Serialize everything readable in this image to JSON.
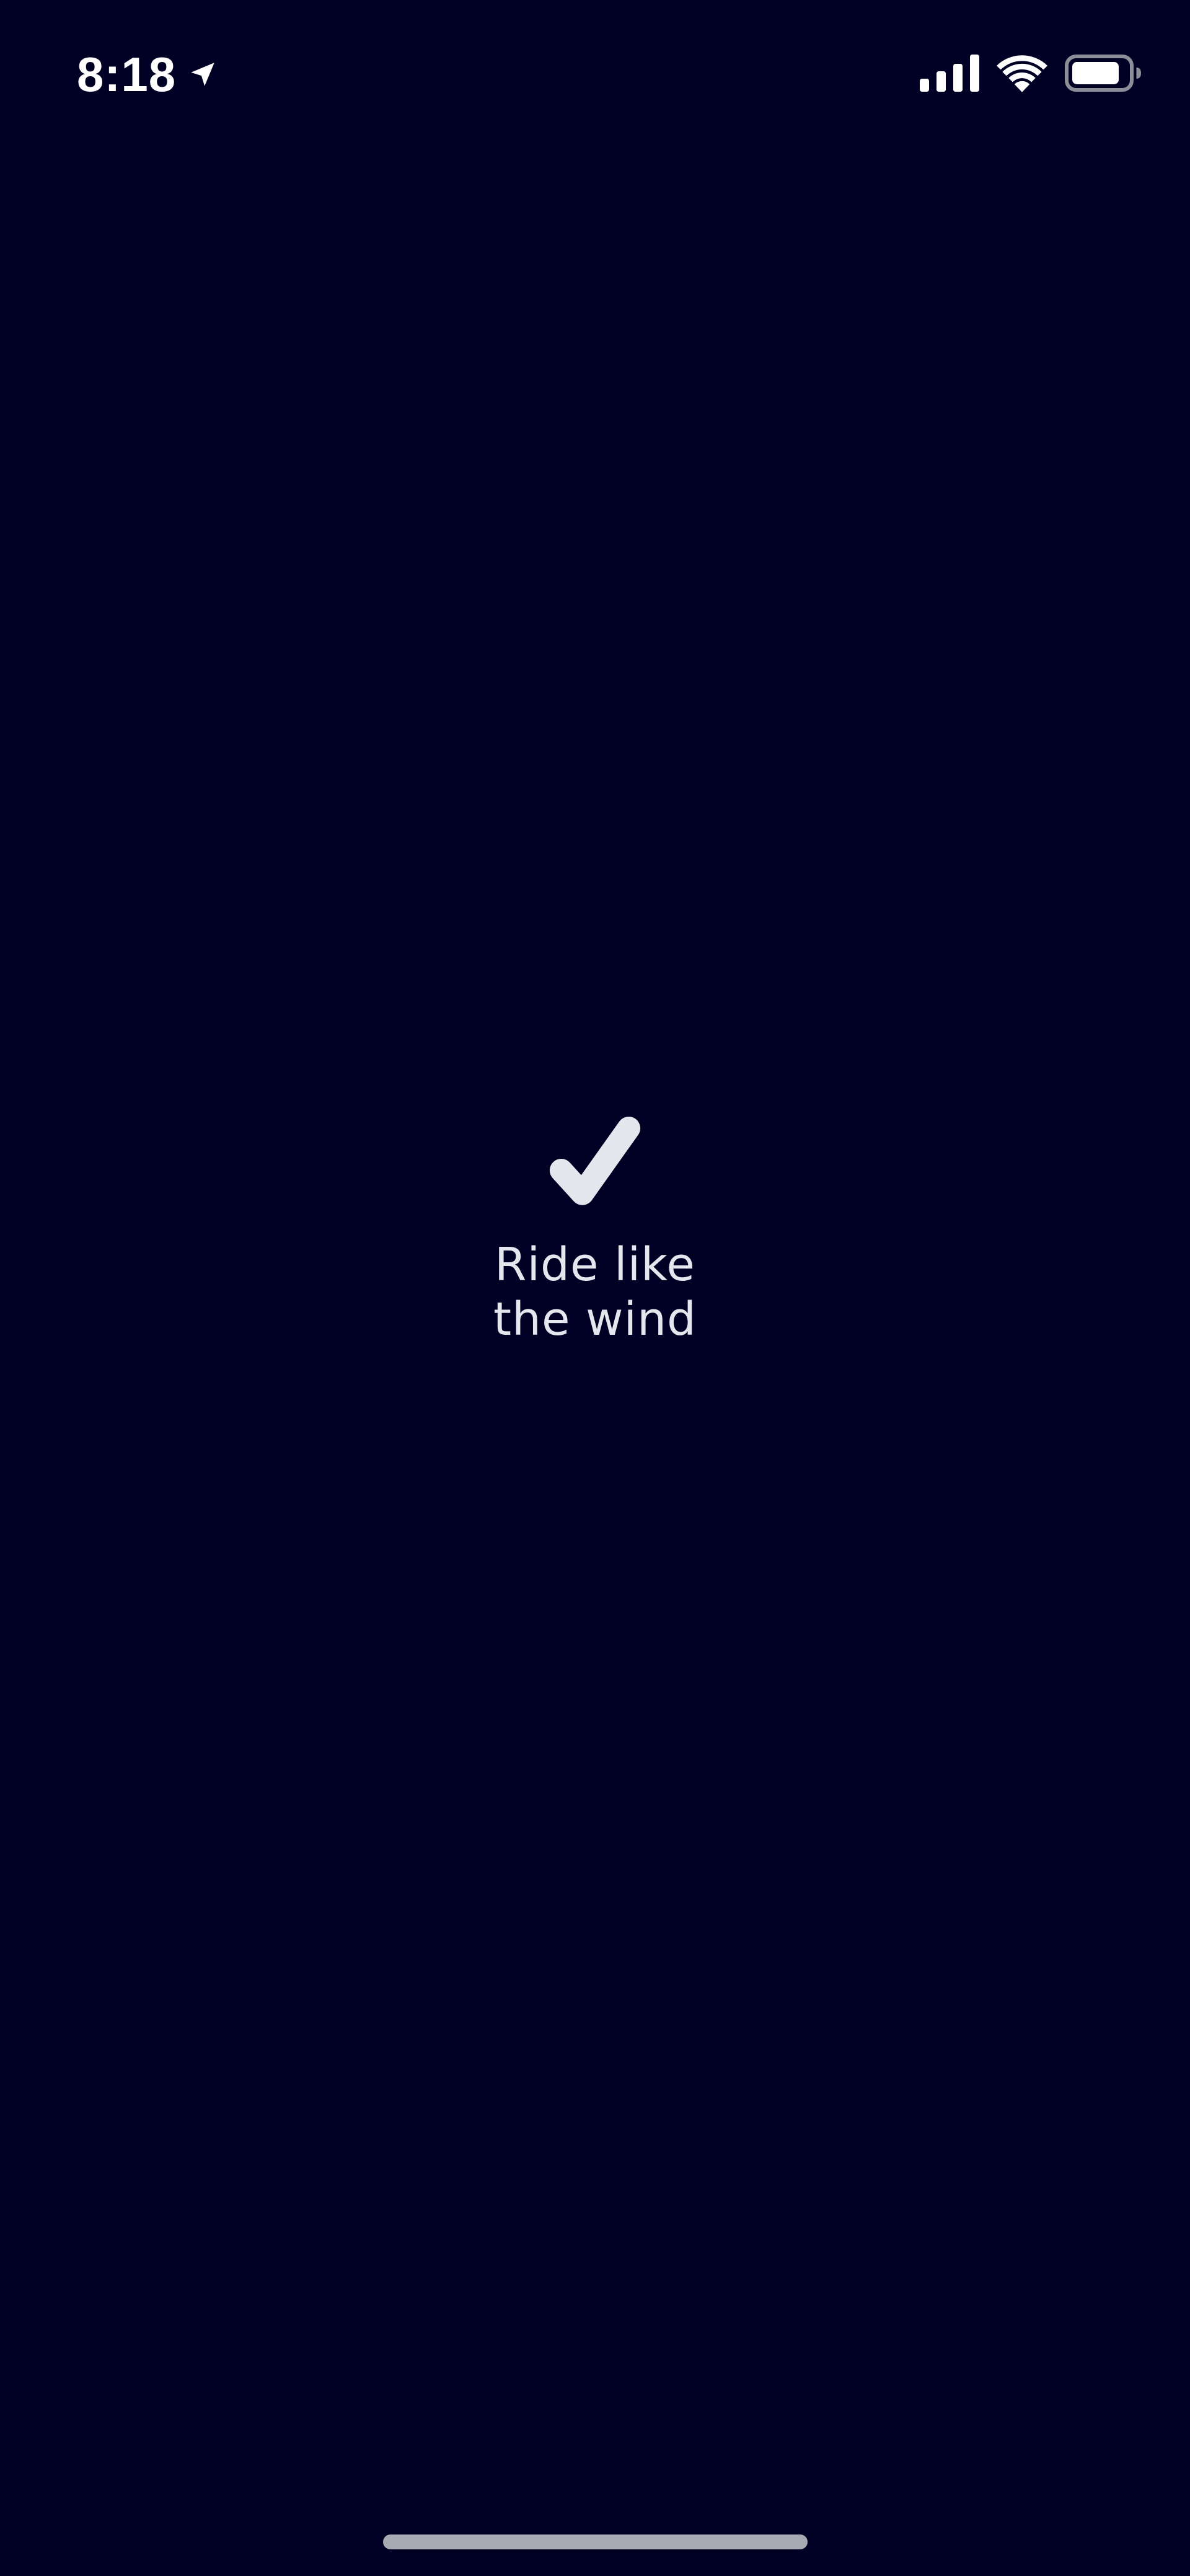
{
  "status_bar": {
    "time": "8:18",
    "location_icon": "location-arrow-icon",
    "signal_icon": "cellular-signal-icon",
    "wifi_icon": "wifi-icon",
    "battery_icon": "battery-icon"
  },
  "main": {
    "icon": "checkmark-icon",
    "tagline_line1": "Ride like",
    "tagline_line2": "the wind"
  },
  "colors": {
    "background": "#000025",
    "text": "#e6e6ee",
    "indicator": "#a9a9b4"
  }
}
